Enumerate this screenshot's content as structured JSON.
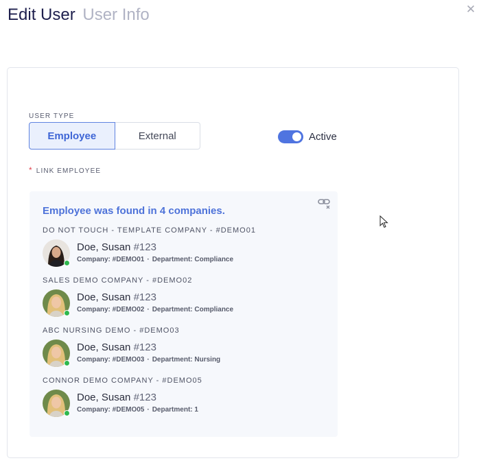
{
  "header": {
    "title": "Edit User",
    "subtitle": "User Info",
    "close_icon": "close-icon"
  },
  "form": {
    "user_type_label": "USER TYPE",
    "user_type_options": [
      "Employee",
      "External"
    ],
    "user_type_selected": "Employee",
    "active_toggle": {
      "label": "Active",
      "on": true
    },
    "link_employee_label": "LINK EMPLOYEE",
    "required_marker": "*"
  },
  "employee_search": {
    "found_message": "Employee was found in 4 companies.",
    "unlink_icon": "unlink-icon",
    "results": [
      {
        "company_label": "DO NOT TOUCH - TEMPLATE COMPANY - #DEMO01",
        "name": "Doe, Susan",
        "number": "#123",
        "company": "Company: #DEMO01",
        "department": "Department: Compliance",
        "status": "online"
      },
      {
        "company_label": "SALES DEMO COMPANY - #DEMO02",
        "name": "Doe, Susan",
        "number": "#123",
        "company": "Company: #DEMO02",
        "department": "Department: Compliance",
        "status": "online"
      },
      {
        "company_label": "ABC NURSING DEMO - #DEMO03",
        "name": "Doe, Susan",
        "number": "#123",
        "company": "Company: #DEMO03",
        "department": "Department: Nursing",
        "status": "online"
      },
      {
        "company_label": "CONNOR DEMO COMPANY - #DEMO05",
        "name": "Doe, Susan",
        "number": "#123",
        "company": "Company: #DEMO05",
        "department": "Department: 1",
        "status": "online"
      }
    ],
    "separator": "·"
  },
  "colors": {
    "accent": "#4f74e0",
    "found_text": "#4d72d9",
    "status_online": "#2fb84f"
  }
}
